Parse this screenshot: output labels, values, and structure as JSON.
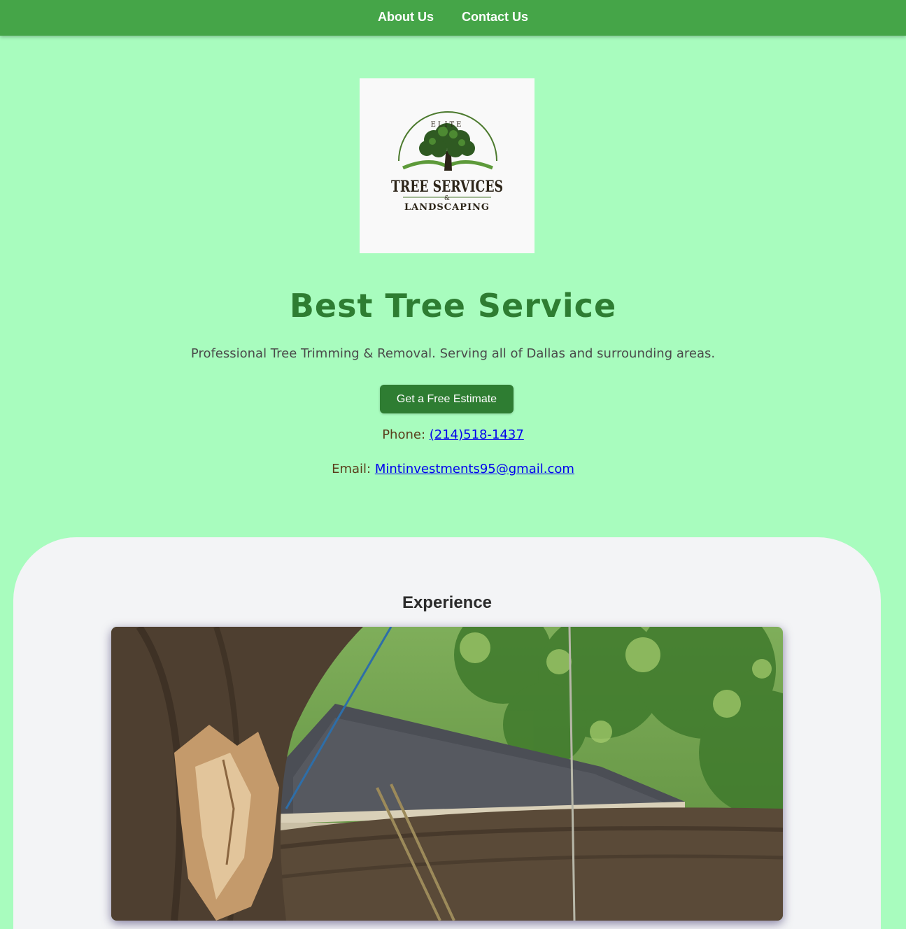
{
  "nav": {
    "items": [
      {
        "label": "About Us"
      },
      {
        "label": "Contact Us"
      }
    ]
  },
  "logo": {
    "top_text": "ELITE",
    "main_text": "TREE SERVICES",
    "amp": "&",
    "bottom_text": "LANDSCAPING"
  },
  "hero": {
    "title": "Best Tree Service",
    "subtitle": "Professional Tree Trimming & Removal. Serving all of Dallas and surrounding areas.",
    "cta_label": "Get a Free Estimate",
    "phone_label": "Phone:",
    "phone_value": "(214)518-1437",
    "email_label": "Email:",
    "email_value": "Mintinvestments95@gmail.com"
  },
  "experience": {
    "title": "Experience"
  },
  "colors": {
    "page_bg": "#a8fcbe",
    "nav_bg": "#45a548",
    "brand_green": "#2e7d32",
    "section_bg": "#f3f4f6",
    "link": "#0000ee"
  }
}
